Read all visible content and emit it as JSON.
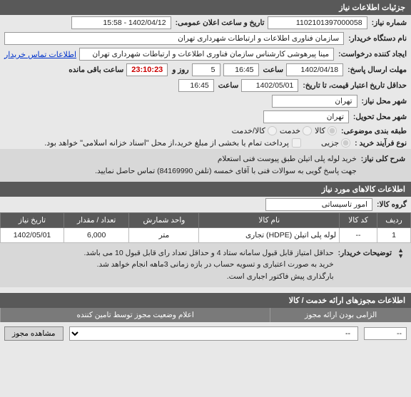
{
  "headers": {
    "main": "جزئیات اطلاعات نیاز",
    "goods": "اطلاعات کالاهای مورد نیاز",
    "service": "اطلاعات مجوزهای ارائه خدمت / کالا"
  },
  "labels": {
    "need_no": "شماره نیاز:",
    "announce_dt": "تاریخ و ساعت اعلان عمومی:",
    "buyer": "نام دستگاه خریدار:",
    "requester": "ایجاد کننده درخواست:",
    "contact_link": "اطلاعات تماس خریدار",
    "deadline": "مهلت ارسال پاسخ:",
    "time": "ساعت",
    "day_and": "روز و",
    "remain": "ساعت باقی مانده",
    "min_valid": "حداقل تاریخ اعتبار قیمت، تا تاریخ:",
    "city_need": "شهر محل نیاز:",
    "city_deliver": "شهر محل تحویل:",
    "category": "طبقه بندی موضوعی:",
    "ptype": "نوع فرآیند خرید :",
    "desc": "شرح کلی نیاز:",
    "goods_group": "گروه کالا:",
    "buyer_notes": "توضیحات خریدار:",
    "mandatory": "الزامی بودن ارائه مجوز",
    "announce_info": "اعلام وضعیت مجوز توسط تامین کننده"
  },
  "values": {
    "need_no": "1102101397000058",
    "announce_dt": "1402/04/12 - 15:58",
    "buyer": "سازمان فناوری اطلاعات و ارتباطات شهرداری تهران",
    "requester": "مینا پیرهوشی کارشناس سازمان فناوری اطلاعات و ارتباطات شهرداری تهران",
    "deadline_date": "1402/04/18",
    "deadline_time": "16:45",
    "days_remain": "5",
    "countdown": "23:10:23",
    "valid_date": "1402/05/01",
    "valid_time": "16:45",
    "city_need": "تهران",
    "city_deliver": "تهران",
    "cat_goods": "کالا",
    "cat_service": "خدمت",
    "cat_both": "کالا/خدمت",
    "ptype_small": "جزیی",
    "ptype_other": "",
    "pay_note": "پرداخت تمام یا بخشی از مبلغ خرید،از محل \"اسناد خزانه اسلامی\" خواهد بود.",
    "desc_line1": "خرید لوله پلی اتیلن طبق پیوست فنی استعلام",
    "desc_line2": "جهت پاسخ گویی به سوالات فنی با آقای خمسه (تلفن 84169990) تماس حاصل نمایید.",
    "goods_group": "امور تاسیساتی",
    "notes_line1": "حداقل امتیاز قابل قبول سامانه ستاد 4 و حداقل تعداد رای قابل قبول 10 می باشد.",
    "notes_line2": "خرید به صورت اعتباری و تسویه حساب در بازه زمانی 3ماهه انجام خواهد شد.",
    "notes_line3": "بارگذاری پیش فاکتور اجباری است."
  },
  "radio_state": {
    "cat_selected": "goods",
    "ptype_selected": "small",
    "pay_checked": false
  },
  "table": {
    "headers": [
      "ردیف",
      "کد کالا",
      "نام کالا",
      "واحد شمارش",
      "تعداد / مقدار",
      "تاریخ نیاز"
    ],
    "row": {
      "idx": "1",
      "code": "--",
      "name": "لوله پلی اتیلن (HDPE) تجاری",
      "unit": "متر",
      "qty": "6,000",
      "date": "1402/05/01"
    }
  },
  "bottom": {
    "mandatory_val": "--",
    "dropdown_val": "--",
    "btn_view": "مشاهده مجوز"
  }
}
